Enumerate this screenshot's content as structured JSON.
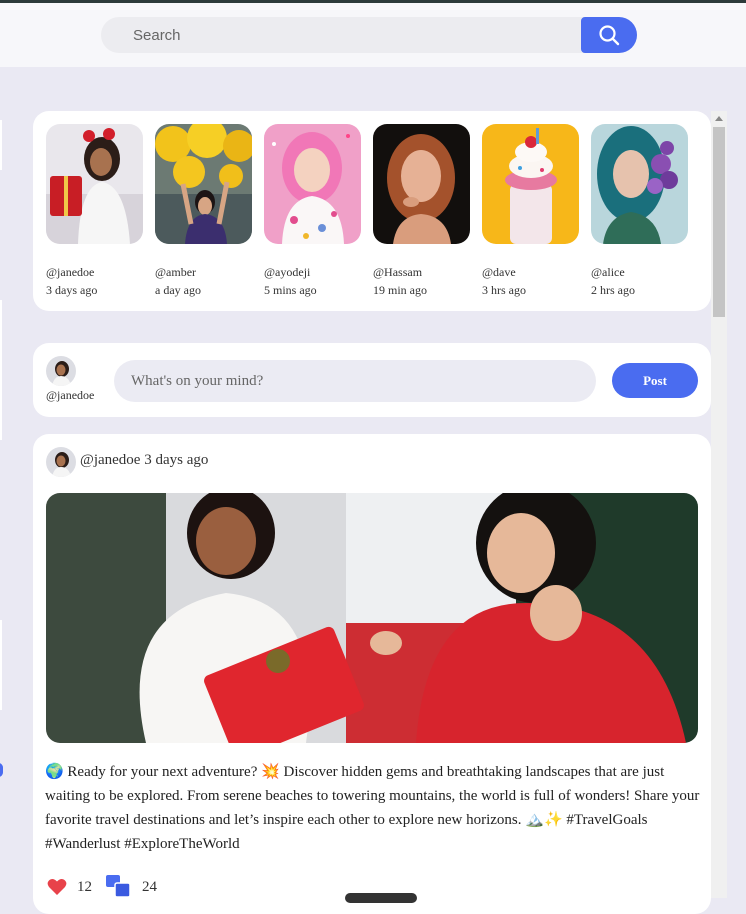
{
  "search": {
    "placeholder": "Search",
    "icon": "search-icon"
  },
  "stories": [
    {
      "username": "@janedoe",
      "time": "3 days ago"
    },
    {
      "username": "@amber",
      "time": "a day ago"
    },
    {
      "username": "@ayodeji",
      "time": "5 mins ago"
    },
    {
      "username": "@Hassam",
      "time": "19 min ago"
    },
    {
      "username": "@dave",
      "time": "3 hrs ago"
    },
    {
      "username": "@alice",
      "time": "2 hrs ago"
    }
  ],
  "composer": {
    "username": "@janedoe",
    "placeholder": "What's on your mind?",
    "post_label": "Post"
  },
  "post": {
    "author_line": "@janedoe 3 days ago",
    "text": "🌍 Ready for your next adventure? 💥 Discover hidden gems and breathtaking landscapes that are just waiting to be explored. From serene beaches to towering mountains, the world is full of wonders! Share your favorite travel destinations and let’s inspire each other to explore new horizons. 🏔️✨ #TravelGoals #Wanderlust #ExploreTheWorld",
    "likes": "12",
    "comments": "24"
  },
  "colors": {
    "accent": "#4a6cf0",
    "background": "#eae9f3",
    "like": "#e8424a"
  }
}
